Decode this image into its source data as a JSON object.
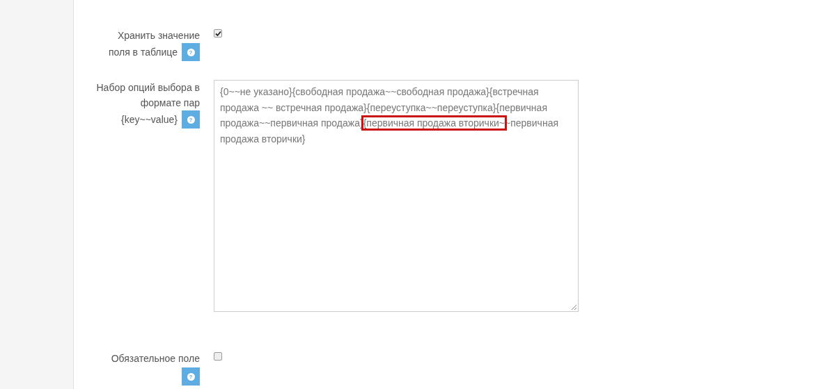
{
  "fields": [
    {
      "kind": "checkbox",
      "label_lines": [
        "Хранить значение",
        "поля в таблице"
      ],
      "help": "?",
      "checked": true
    },
    {
      "kind": "textarea",
      "label_lines": [
        "Набор опций выбора в",
        "формате пар",
        "{key~~value}"
      ],
      "help": "?",
      "value_parts": [
        {
          "text": "{0~~не указано}{свободная продажа~~свободная продажа}{встречная продажа ~~ встречная продажа}{переуступка~~переуступка}{первичная продажа~~первичная продажа}",
          "highlighted": false
        },
        {
          "text": "{первичная продажа вторички~",
          "highlighted": true
        },
        {
          "text": "~первичная продажа вторички}",
          "highlighted": false
        }
      ]
    },
    {
      "kind": "checkbox",
      "label_lines": [
        "Обязательное поле"
      ],
      "help": "?",
      "checked": false
    }
  ]
}
